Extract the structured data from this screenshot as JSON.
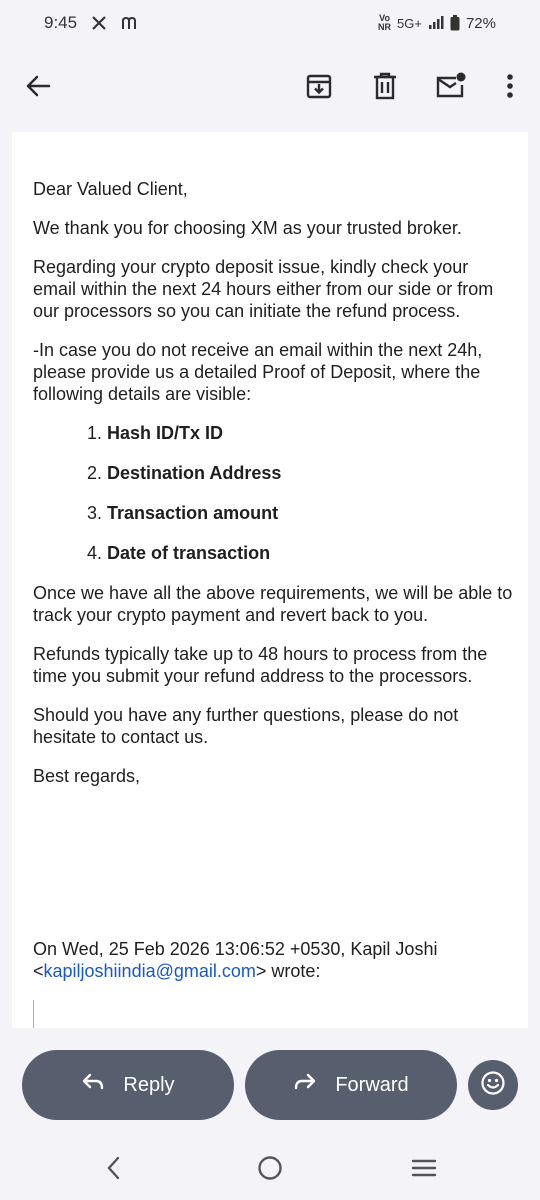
{
  "status_bar": {
    "time": "9:45",
    "notif_icons": [
      "x-logo-icon",
      "m-icon"
    ],
    "network": "5G+",
    "vonr_top": "Vo",
    "vonr_bottom": "NR",
    "battery": "72%"
  },
  "toolbar": {
    "icons": [
      "back-arrow-icon",
      "archive-icon",
      "delete-icon",
      "mark-unread-icon",
      "more-vert-icon"
    ]
  },
  "email": {
    "greeting": "Dear Valued Client,",
    "p1": "We thank you for choosing XM as your trusted broker.",
    "p2": "Regarding your crypto deposit issue, kindly check your email within the next 24 hours either from our side or from our processors so you can initiate the refund process.",
    "p3": "-In case you do not receive an email within the next 24h, please provide us a detailed Proof of Deposit, where the following details are visible:",
    "list": [
      {
        "num": "1.",
        "text": "Hash ID/Tx ID"
      },
      {
        "num": "2.",
        "text": "Destination Address"
      },
      {
        "num": "3.",
        "text": "Transaction amount"
      },
      {
        "num": "4.",
        "text": "Date of transaction"
      }
    ],
    "p4": "Once we have all the above requirements, we will be able to track your crypto payment and revert back to you.",
    "p5": "Refunds typically take up to 48 hours to process from the time you submit your refund address to the processors.",
    "p6": "Should you have any further questions, please do not hesitate to contact us.",
    "signoff": "Best regards,",
    "quote_prefix": "On Wed, 25 Feb 2026 13:06:52 +0530, Kapil Joshi <",
    "quote_email": "kapiljoshiindia@gmail.com",
    "quote_suffix": "> wrote:"
  },
  "actions": {
    "reply_label": "Reply",
    "forward_label": "Forward"
  },
  "colors": {
    "background": "#f4f3f8",
    "card": "#ffffff",
    "action_button": "#575f6e",
    "link": "#1a57c7"
  }
}
